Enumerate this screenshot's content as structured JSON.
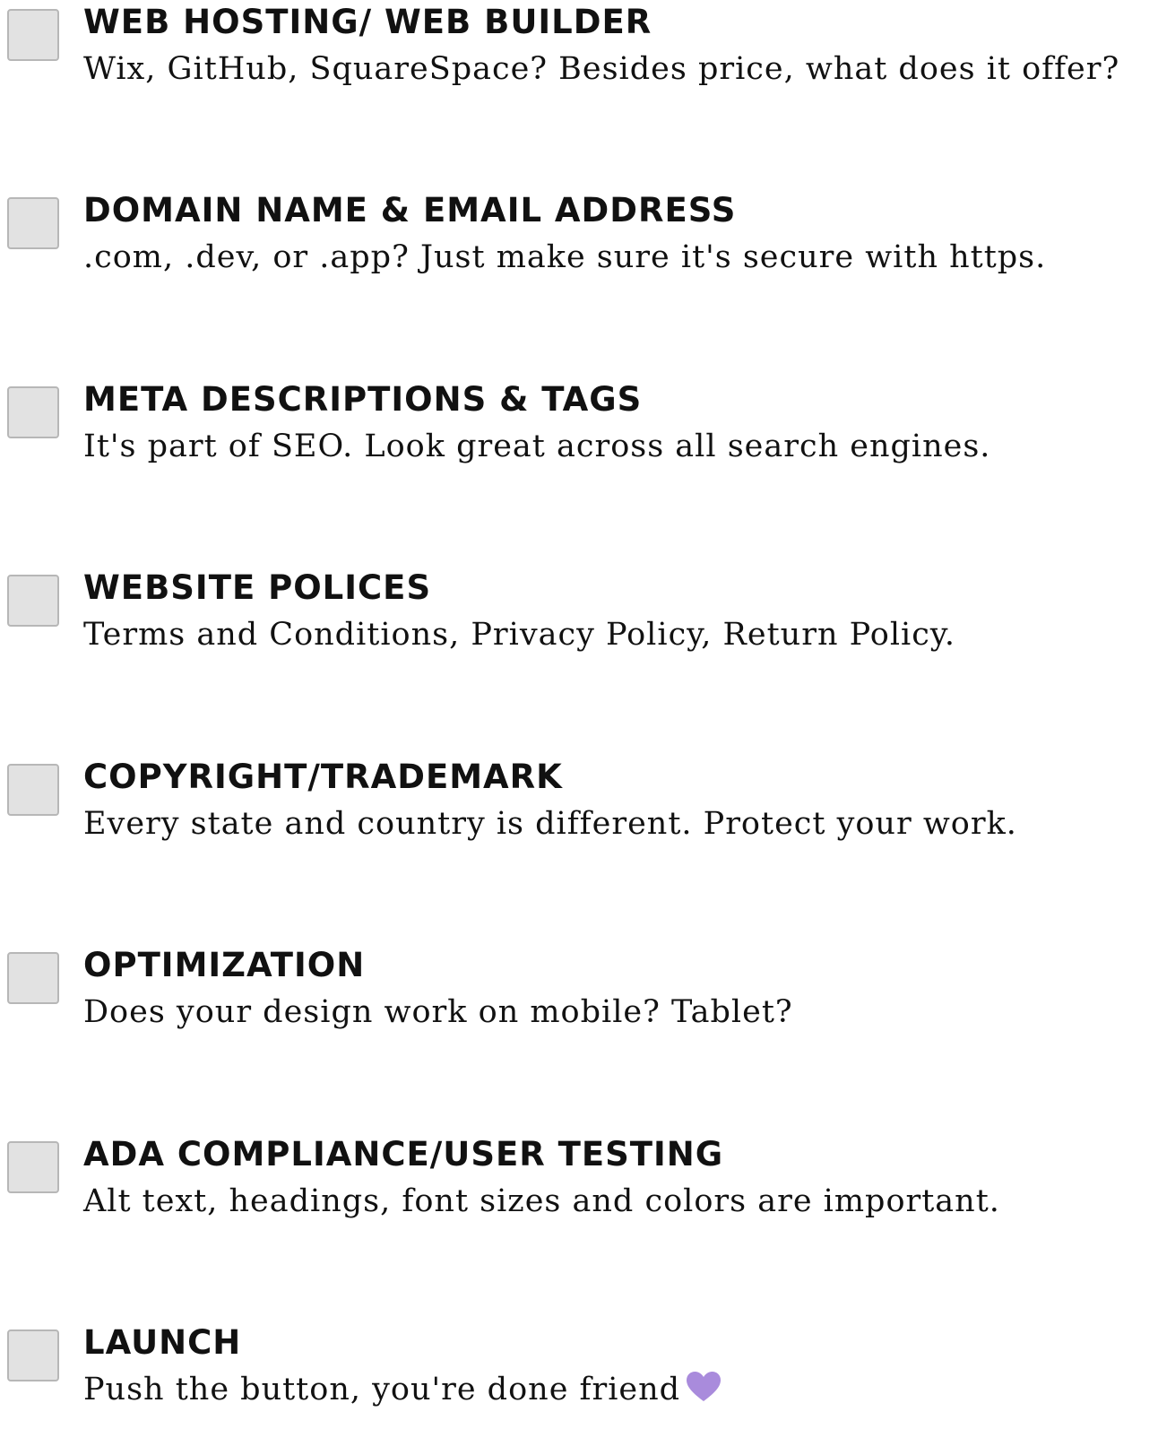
{
  "checklist": {
    "items": [
      {
        "title": "WEB HOSTING/ WEB BUILDER",
        "description": "Wix, GitHub, SquareSpace? Besides price, what does it offer?",
        "checked": false
      },
      {
        "title": "DOMAIN NAME & EMAIL ADDRESS",
        "description": ".com, .dev, or .app? Just make sure it's secure with https.",
        "checked": false
      },
      {
        "title": "META DESCRIPTIONS & TAGS",
        "description": "It's part of SEO. Look great across all search engines.",
        "checked": false
      },
      {
        "title": "WEBSITE POLICES",
        "description": "Terms and Conditions, Privacy Policy, Return Policy.",
        "checked": false
      },
      {
        "title": "COPYRIGHT/TRADEMARK",
        "description": "Every state and country is different. Protect your work.",
        "checked": false
      },
      {
        "title": "OPTIMIZATION",
        "description": "Does your design work on mobile? Tablet?",
        "checked": false
      },
      {
        "title": "ADA COMPLIANCE/USER TESTING",
        "description": "Alt text, headings, font sizes and colors are important.",
        "checked": false
      },
      {
        "title": "LAUNCH",
        "description": "Push the button, you're done friend",
        "checked": false,
        "trailing_icon": "purple-heart-icon"
      }
    ]
  },
  "colors": {
    "checkbox_fill": "#e2e2e2",
    "checkbox_border": "#b7b7b7",
    "heart": "#a98bdc"
  }
}
